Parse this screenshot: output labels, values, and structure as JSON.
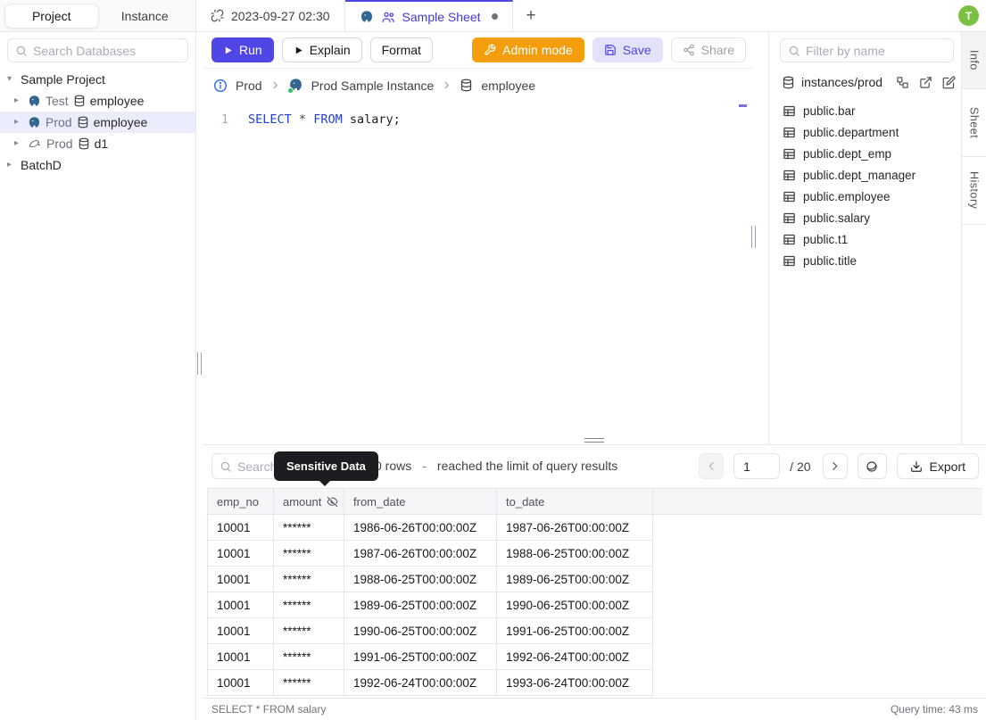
{
  "header": {
    "project_tab": "Project",
    "instance_tab": "Instance",
    "timestamp_tab": "2023-09-27 02:30",
    "sheet_tab": "Sample Sheet",
    "new_tab": "+",
    "avatar_initial": "T"
  },
  "sidebar": {
    "search_placeholder": "Search Databases",
    "tree": {
      "root_label": "Sample Project",
      "items": [
        {
          "env": "Test",
          "db": "employee",
          "engine": "postgres"
        },
        {
          "env": "Prod",
          "db": "employee",
          "engine": "postgres"
        },
        {
          "env": "Prod",
          "db": "d1",
          "engine": "mysql"
        }
      ],
      "batch_label": "BatchD"
    }
  },
  "toolbar": {
    "run": "Run",
    "explain": "Explain",
    "format": "Format",
    "admin_mode": "Admin mode",
    "save": "Save",
    "share": "Share"
  },
  "breadcrumb": {
    "environment": "Prod",
    "instance": "Prod Sample Instance",
    "database": "employee"
  },
  "editor": {
    "line_number": "1",
    "keyword_select": "SELECT",
    "star": "*",
    "keyword_from": "FROM",
    "identifier": "salary;"
  },
  "schema_panel": {
    "filter_placeholder": "Filter by name",
    "connection_path": "instances/prod",
    "tables": [
      "public.bar",
      "public.department",
      "public.dept_emp",
      "public.dept_manager",
      "public.employee",
      "public.salary",
      "public.t1",
      "public.title"
    ]
  },
  "side_tabs": [
    "Info",
    "Sheet",
    "History"
  ],
  "results": {
    "search_placeholder": "Search",
    "tooltip": "Sensitive Data",
    "rows_count": "0 rows",
    "rows_separator": "-",
    "rows_message": "reached the limit of query results",
    "page_value": "1",
    "page_total": "/ 20",
    "export_label": "Export",
    "table": {
      "columns": [
        "emp_no",
        "amount",
        "from_date",
        "to_date"
      ],
      "rows": [
        [
          "10001",
          "******",
          "1986-06-26T00:00:00Z",
          "1987-06-26T00:00:00Z"
        ],
        [
          "10001",
          "******",
          "1987-06-26T00:00:00Z",
          "1988-06-25T00:00:00Z"
        ],
        [
          "10001",
          "******",
          "1988-06-25T00:00:00Z",
          "1989-06-25T00:00:00Z"
        ],
        [
          "10001",
          "******",
          "1989-06-25T00:00:00Z",
          "1990-06-25T00:00:00Z"
        ],
        [
          "10001",
          "******",
          "1990-06-25T00:00:00Z",
          "1991-06-25T00:00:00Z"
        ],
        [
          "10001",
          "******",
          "1991-06-25T00:00:00Z",
          "1992-06-24T00:00:00Z"
        ],
        [
          "10001",
          "******",
          "1992-06-24T00:00:00Z",
          "1993-06-24T00:00:00Z"
        ]
      ]
    }
  },
  "statusbar": {
    "query": "SELECT * FROM salary",
    "query_time": "Query time: 43 ms"
  },
  "colors": {
    "accent": "#4f46e5",
    "admin_orange": "#f59e0b",
    "avatar_green": "#7bc043",
    "tooltip_bg": "#1c1c21"
  }
}
